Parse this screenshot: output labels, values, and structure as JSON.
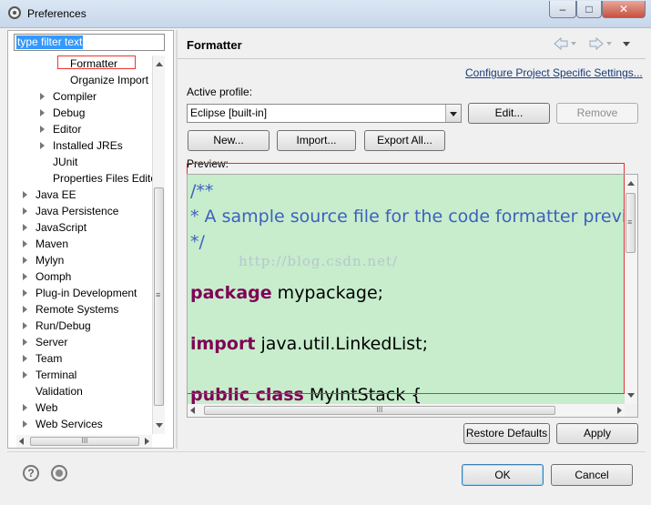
{
  "window": {
    "title": "Preferences",
    "minimize": "–",
    "maximize": "□",
    "close": "✕"
  },
  "filter": {
    "placeholder": "type filter text"
  },
  "tree": {
    "items": [
      {
        "label": "Formatter"
      },
      {
        "label": "Organize Import"
      },
      {
        "label": "Compiler"
      },
      {
        "label": "Debug"
      },
      {
        "label": "Editor"
      },
      {
        "label": "Installed JREs"
      },
      {
        "label": "JUnit"
      },
      {
        "label": "Properties Files Editor"
      },
      {
        "label": "Java EE"
      },
      {
        "label": "Java Persistence"
      },
      {
        "label": "JavaScript"
      },
      {
        "label": "Maven"
      },
      {
        "label": "Mylyn"
      },
      {
        "label": "Oomph"
      },
      {
        "label": "Plug-in Development"
      },
      {
        "label": "Remote Systems"
      },
      {
        "label": "Run/Debug"
      },
      {
        "label": "Server"
      },
      {
        "label": "Team"
      },
      {
        "label": "Terminal"
      },
      {
        "label": "Validation"
      },
      {
        "label": "Web"
      },
      {
        "label": "Web Services"
      }
    ],
    "scroll_grip": "≡",
    "hscroll_grip": "III"
  },
  "page": {
    "title": "Formatter",
    "configure_link": "Configure Project Specific Settings...",
    "active_profile_label": "Active profile:",
    "profile_value": "Eclipse [built-in]",
    "edit_label": "Edit...",
    "remove_label": "Remove",
    "new_label": "New...",
    "import_label": "Import...",
    "export_label": "Export All...",
    "preview_label": "Preview:",
    "preview_hscroll_grip": "III",
    "preview_vscroll_grip": "≡"
  },
  "preview": {
    "comment_lines": [
      "/**",
      "* A sample source file for the code formatter preview",
      "*/"
    ],
    "package_kw": "package",
    "package_name": " mypackage;",
    "import_kw": "import",
    "import_name": " java.util.LinkedList;",
    "class_kw": "public class",
    "class_name": " MyIntStack {",
    "watermark": "http://blog.csdn.net/"
  },
  "footer": {
    "restore_defaults": "Restore Defaults",
    "apply": "Apply",
    "ok": "OK",
    "cancel": "Cancel",
    "help_icon_glyph": "?"
  },
  "nav_icons": [
    "back-arrow-icon",
    "forward-arrow-icon",
    "dropdown-icon"
  ]
}
